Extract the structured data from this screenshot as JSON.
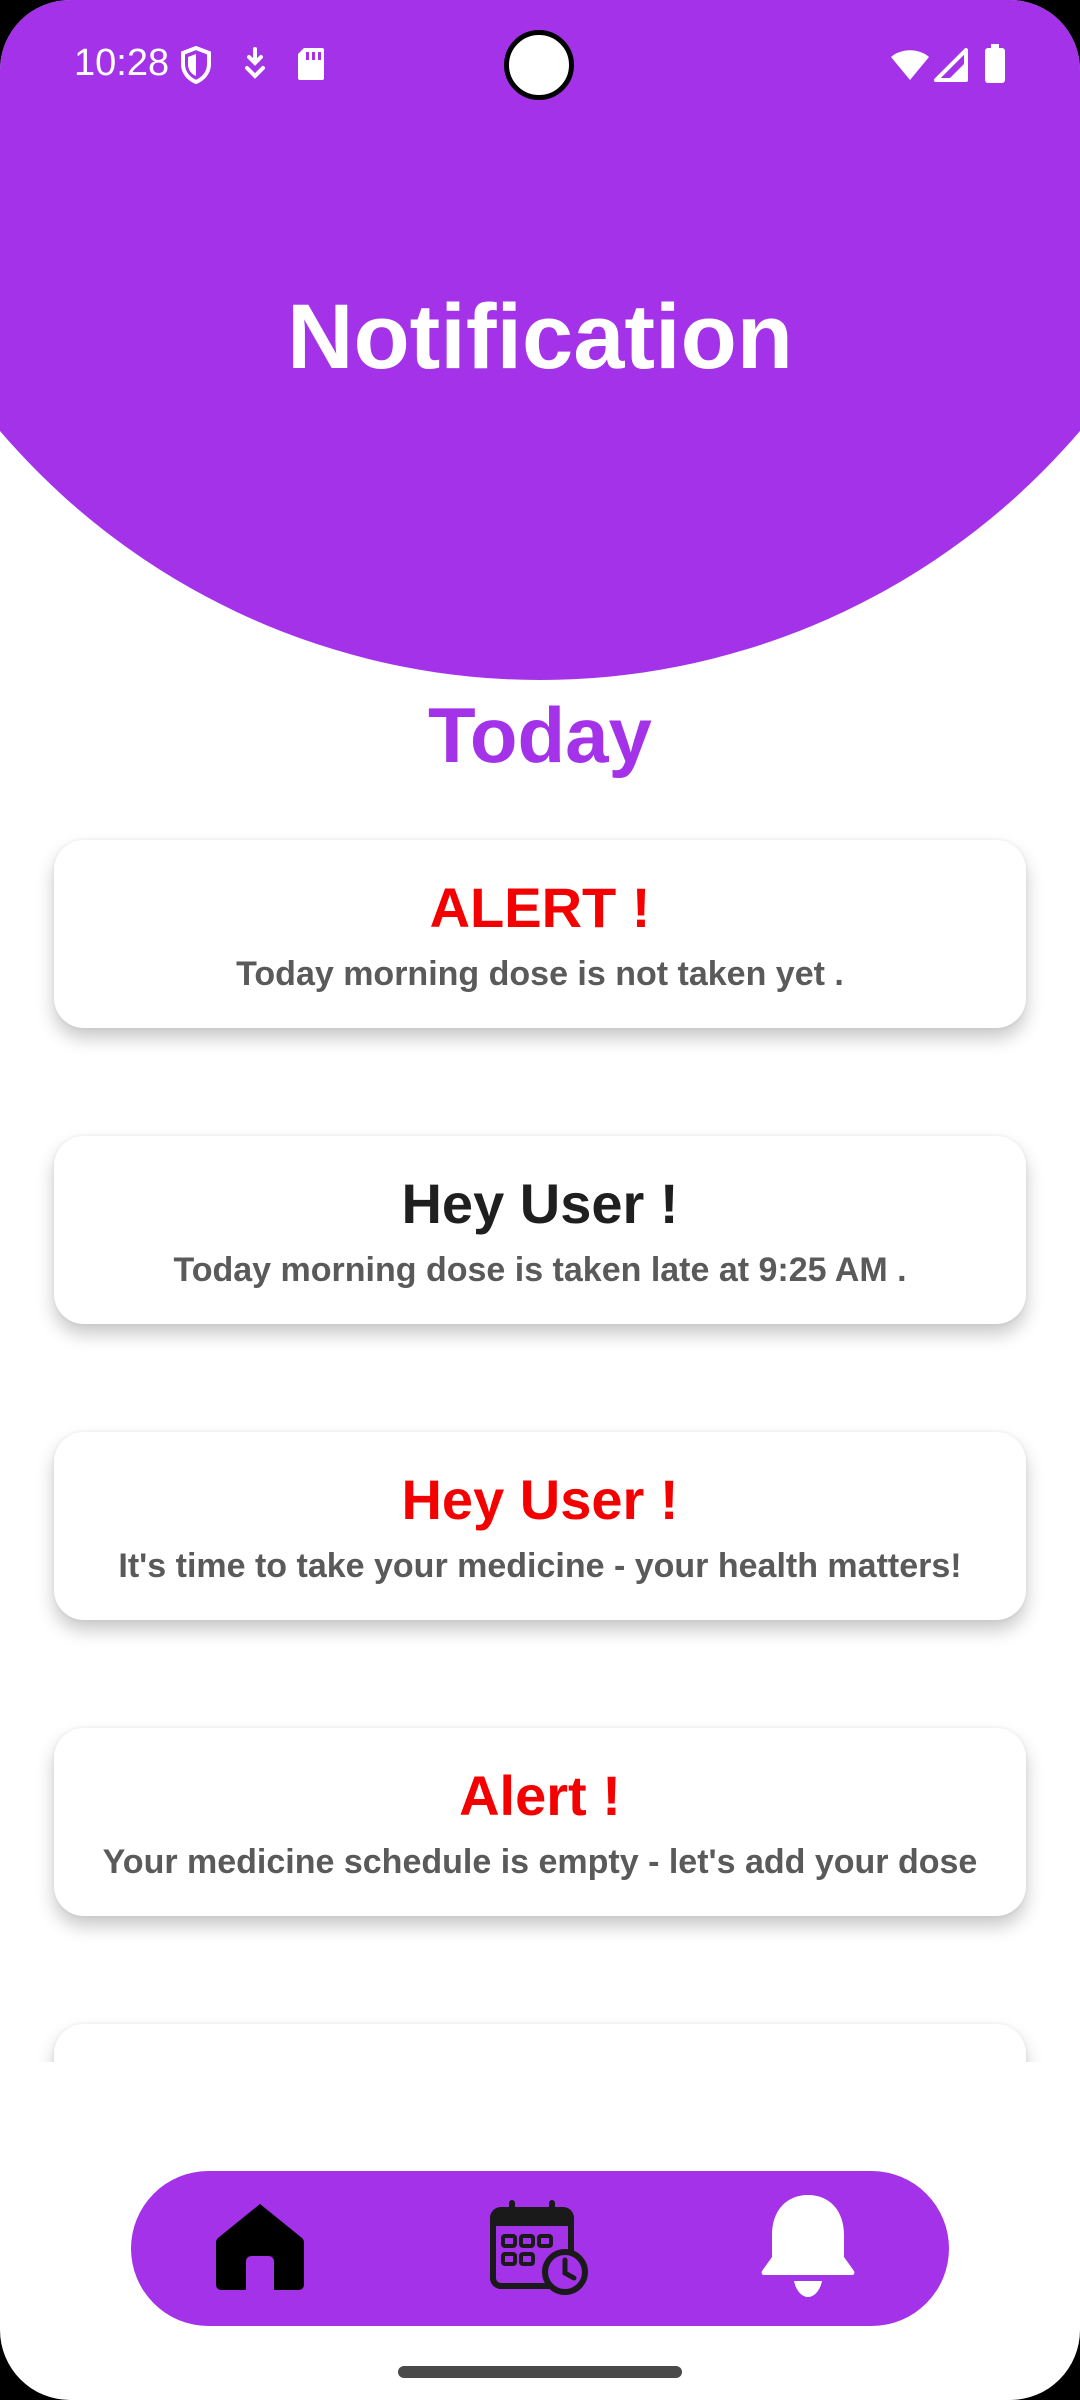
{
  "status_bar": {
    "time": "10:28",
    "left_icons": [
      "shield-icon",
      "download-icon",
      "sd-card-icon"
    ],
    "right_icons": [
      "wifi-icon",
      "signal-icon",
      "battery-icon"
    ]
  },
  "header": {
    "title": "Notification"
  },
  "section": {
    "title": "Today"
  },
  "notifications": [
    {
      "title": "ALERT !",
      "text": "Today morning dose is not taken yet .",
      "title_color": "#f40000"
    },
    {
      "title": "Hey User !",
      "text": "Today morning dose is taken late at 9:25 AM .",
      "title_color": "#1f1f1f"
    },
    {
      "title": "Hey User !",
      "text": "It's time to take your medicine - your health matters!",
      "title_color": "#f40000"
    },
    {
      "title": "Alert !",
      "text": "Your medicine schedule is empty - let's add your dose",
      "title_color": "#f40000"
    },
    {
      "title": "",
      "text": "",
      "title_color": "#f40000"
    }
  ],
  "bottom_nav": {
    "items": [
      {
        "icon": "home-icon",
        "active": false
      },
      {
        "icon": "calendar-clock-icon",
        "active": false
      },
      {
        "icon": "bell-icon",
        "active": true
      }
    ]
  },
  "colors": {
    "accent": "#a332e8",
    "alert_red": "#f40000",
    "text_gray": "#5a5a5a"
  }
}
